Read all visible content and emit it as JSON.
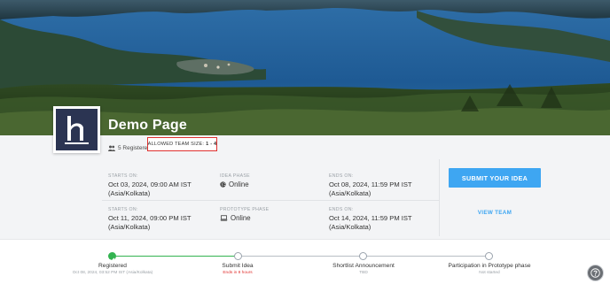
{
  "event": {
    "title": "Demo Page",
    "registered_text": "5 Registered",
    "team_size_label": "ALLOWED TEAM SIZE:",
    "team_size_value": "1 - 4"
  },
  "phases": [
    {
      "starts_label": "STARTS ON:",
      "starts_date": "Oct 03, 2024, 09:00 AM IST",
      "starts_tz": "(Asia/Kolkata)",
      "phase_label": "IDEA PHASE",
      "phase_mode": "Online",
      "phase_icon": "globe-icon",
      "ends_label": "ENDS ON:",
      "ends_date": "Oct 08, 2024, 11:59 PM IST",
      "ends_tz": "(Asia/Kolkata)"
    },
    {
      "starts_label": "STARTS ON:",
      "starts_date": "Oct 11, 2024, 09:00 PM IST",
      "starts_tz": "(Asia/Kolkata)",
      "phase_label": "PROTOTYPE PHASE",
      "phase_mode": "Online",
      "phase_icon": "laptop-icon",
      "ends_label": "ENDS ON:",
      "ends_date": "Oct 14, 2024, 11:59 PM IST",
      "ends_tz": "(Asia/Kolkata)"
    }
  ],
  "actions": {
    "submit_label": "SUBMIT YOUR IDEA",
    "view_team_label": "VIEW TEAM"
  },
  "timeline": [
    {
      "label": "Registered",
      "sub": "Oct 08, 2024, 03:52 PM IST (Asia/Kolkata)",
      "state": "done"
    },
    {
      "label": "Submit Idea",
      "sub": "Ends in 8 hours",
      "state": "current"
    },
    {
      "label": "Shortlist Announcement",
      "sub": "TBD",
      "state": "todo"
    },
    {
      "label": "Participation in Prototype phase",
      "sub": "Not started",
      "state": "todo"
    }
  ],
  "colors": {
    "accent": "#3ea6f2",
    "done": "#33b350",
    "highlight_border": "#e0312f",
    "warning_text": "#e0312f"
  },
  "icons": {
    "logo": "h-logo",
    "registered": "people-icon",
    "help": "question-icon"
  }
}
